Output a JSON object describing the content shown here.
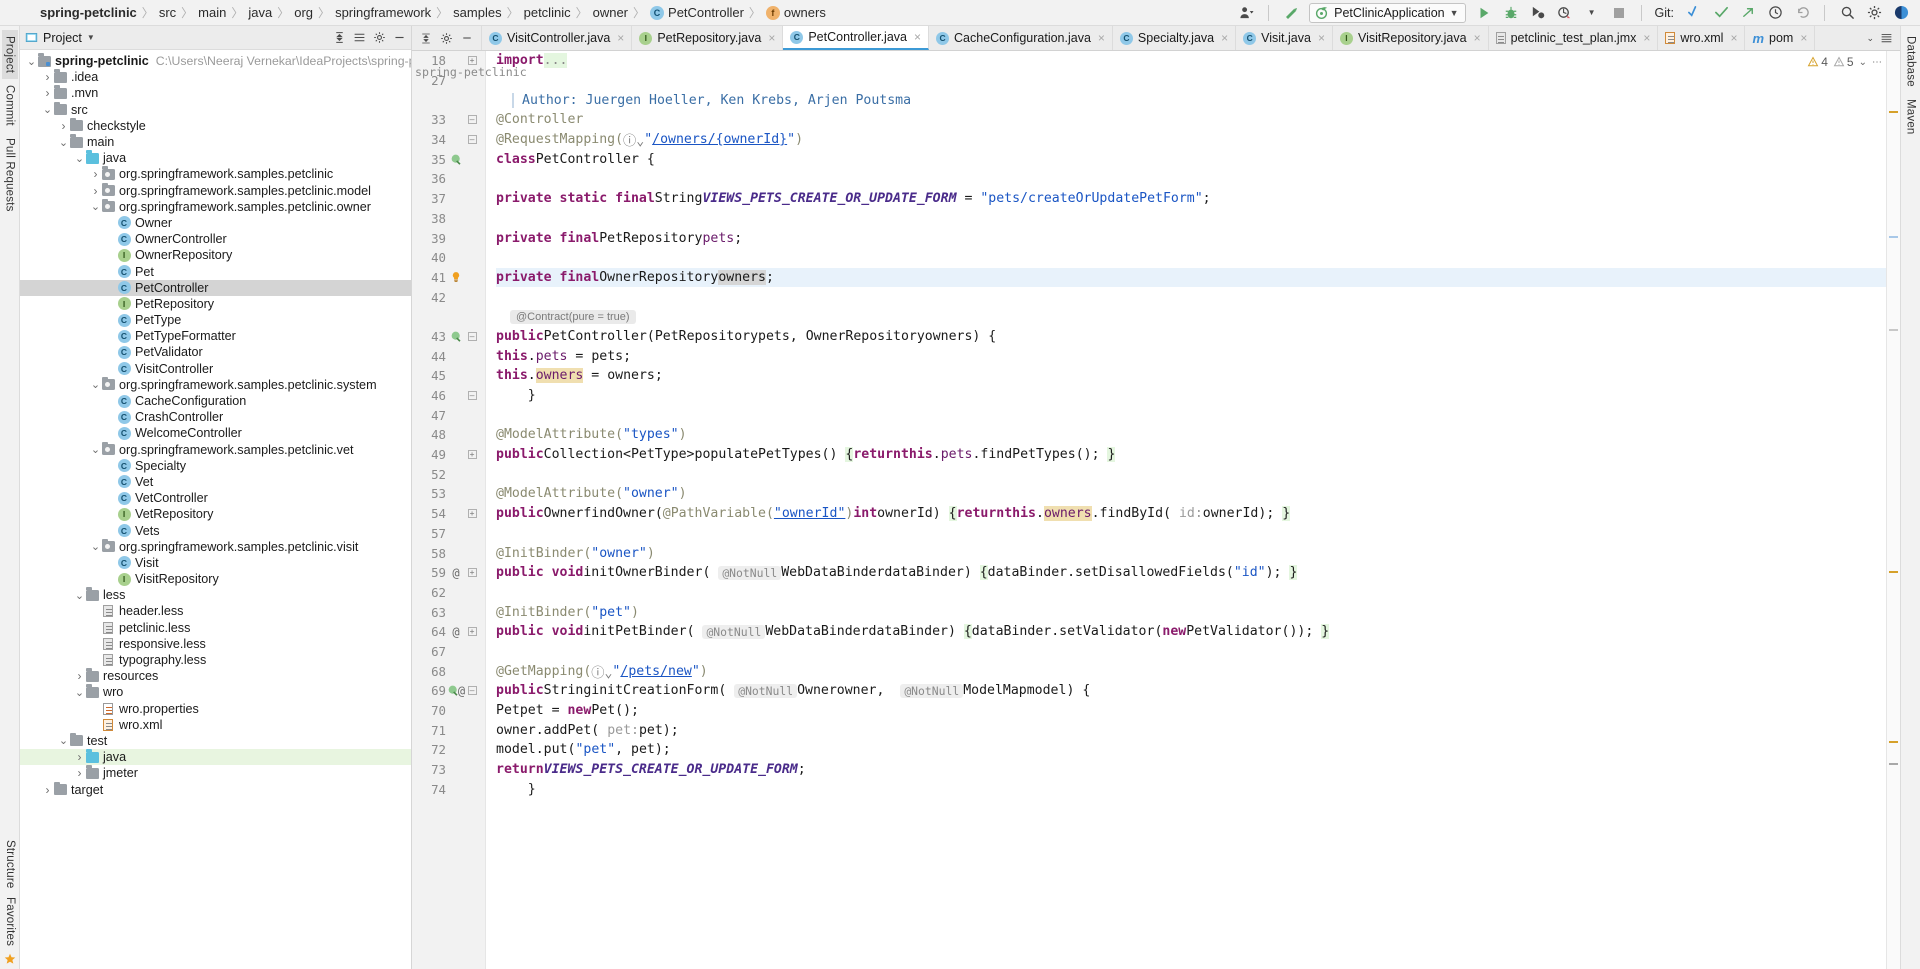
{
  "navbar": {
    "breadcrumbs": [
      {
        "label": "spring-petclinic",
        "bold": true,
        "icon": null
      },
      {
        "label": "src",
        "icon": null
      },
      {
        "label": "main",
        "icon": null
      },
      {
        "label": "java",
        "icon": null
      },
      {
        "label": "org",
        "icon": null
      },
      {
        "label": "springframework",
        "icon": null
      },
      {
        "label": "samples",
        "icon": null
      },
      {
        "label": "petclinic",
        "icon": null
      },
      {
        "label": "owner",
        "icon": null
      },
      {
        "label": "PetController",
        "icon": "class-icon"
      },
      {
        "label": "owners",
        "icon": "field-icon"
      }
    ],
    "run_config": "PetClinicApplication",
    "git_label": "Git:",
    "icons": [
      "user-avatar-icon",
      "dropdown-icon",
      "updates-icon",
      "run-icon",
      "debug-icon",
      "run-with-coverage-icon",
      "profiler-icon",
      "stop-icon",
      "update-project-icon",
      "commit-icon",
      "push-icon",
      "history-icon",
      "rollback-icon",
      "search-everywhere-icon",
      "settings-icon",
      "ide-features-icon"
    ]
  },
  "left_strip": {
    "tabs": [
      "Project",
      "Commit",
      "Pull Requests"
    ],
    "active": "Project",
    "bottom": [
      "Structure",
      "Favorites",
      "bookmark-star-icon"
    ]
  },
  "right_strip": {
    "tabs": [
      "Database",
      "Maven"
    ]
  },
  "project_panel": {
    "title": "Project",
    "header_icons": [
      "collapse-all-icon",
      "expand-icon",
      "settings-icon",
      "hide-icon"
    ],
    "tree": [
      {
        "depth": 0,
        "label": "spring-petclinic",
        "icon": "module-folder",
        "arrow": "down",
        "bold": true,
        "path": "C:\\Users\\Neeraj Vernekar\\IdeaProjects\\spring-petclinic"
      },
      {
        "depth": 1,
        "label": ".idea",
        "icon": "folder",
        "arrow": "right"
      },
      {
        "depth": 1,
        "label": ".mvn",
        "icon": "folder",
        "arrow": "right"
      },
      {
        "depth": 1,
        "label": "src",
        "icon": "folder",
        "arrow": "down"
      },
      {
        "depth": 2,
        "label": "checkstyle",
        "icon": "folder",
        "arrow": "right"
      },
      {
        "depth": 2,
        "label": "main",
        "icon": "folder",
        "arrow": "down"
      },
      {
        "depth": 3,
        "label": "java",
        "icon": "source-folder",
        "arrow": "down"
      },
      {
        "depth": 4,
        "label": "org.springframework.samples.petclinic",
        "icon": "package",
        "arrow": "right"
      },
      {
        "depth": 4,
        "label": "org.springframework.samples.petclinic.model",
        "icon": "package",
        "arrow": "right"
      },
      {
        "depth": 4,
        "label": "org.springframework.samples.petclinic.owner",
        "icon": "package",
        "arrow": "down"
      },
      {
        "depth": 5,
        "label": "Owner",
        "icon": "class"
      },
      {
        "depth": 5,
        "label": "OwnerController",
        "icon": "class"
      },
      {
        "depth": 5,
        "label": "OwnerRepository",
        "icon": "interface"
      },
      {
        "depth": 5,
        "label": "Pet",
        "icon": "class"
      },
      {
        "depth": 5,
        "label": "PetController",
        "icon": "class",
        "selected": true
      },
      {
        "depth": 5,
        "label": "PetRepository",
        "icon": "interface"
      },
      {
        "depth": 5,
        "label": "PetType",
        "icon": "class"
      },
      {
        "depth": 5,
        "label": "PetTypeFormatter",
        "icon": "class"
      },
      {
        "depth": 5,
        "label": "PetValidator",
        "icon": "class"
      },
      {
        "depth": 5,
        "label": "VisitController",
        "icon": "class"
      },
      {
        "depth": 4,
        "label": "org.springframework.samples.petclinic.system",
        "icon": "package",
        "arrow": "down"
      },
      {
        "depth": 5,
        "label": "CacheConfiguration",
        "icon": "class"
      },
      {
        "depth": 5,
        "label": "CrashController",
        "icon": "class"
      },
      {
        "depth": 5,
        "label": "WelcomeController",
        "icon": "class"
      },
      {
        "depth": 4,
        "label": "org.springframework.samples.petclinic.vet",
        "icon": "package",
        "arrow": "down"
      },
      {
        "depth": 5,
        "label": "Specialty",
        "icon": "class"
      },
      {
        "depth": 5,
        "label": "Vet",
        "icon": "class"
      },
      {
        "depth": 5,
        "label": "VetController",
        "icon": "class"
      },
      {
        "depth": 5,
        "label": "VetRepository",
        "icon": "interface"
      },
      {
        "depth": 5,
        "label": "Vets",
        "icon": "class"
      },
      {
        "depth": 4,
        "label": "org.springframework.samples.petclinic.visit",
        "icon": "package",
        "arrow": "down"
      },
      {
        "depth": 5,
        "label": "Visit",
        "icon": "class"
      },
      {
        "depth": 5,
        "label": "VisitRepository",
        "icon": "interface"
      },
      {
        "depth": 3,
        "label": "less",
        "icon": "folder",
        "arrow": "down"
      },
      {
        "depth": 4,
        "label": "header.less",
        "icon": "file"
      },
      {
        "depth": 4,
        "label": "petclinic.less",
        "icon": "file"
      },
      {
        "depth": 4,
        "label": "responsive.less",
        "icon": "file"
      },
      {
        "depth": 4,
        "label": "typography.less",
        "icon": "file"
      },
      {
        "depth": 3,
        "label": "resources",
        "icon": "folder",
        "arrow": "right"
      },
      {
        "depth": 3,
        "label": "wro",
        "icon": "folder",
        "arrow": "down"
      },
      {
        "depth": 4,
        "label": "wro.properties",
        "icon": "properties-file"
      },
      {
        "depth": 4,
        "label": "wro.xml",
        "icon": "xml-file"
      },
      {
        "depth": 2,
        "label": "test",
        "icon": "folder",
        "arrow": "down"
      },
      {
        "depth": 3,
        "label": "java",
        "icon": "source-folder",
        "arrow": "right",
        "green": true
      },
      {
        "depth": 3,
        "label": "jmeter",
        "icon": "folder",
        "arrow": "right"
      },
      {
        "depth": 1,
        "label": "target",
        "icon": "folder",
        "arrow": "right"
      }
    ]
  },
  "editor": {
    "tab_controls": [
      "collapse-icon",
      "settings-icon",
      "minimize-icon"
    ],
    "tabs": [
      {
        "label": "VisitController.java",
        "icon": "class",
        "active": false
      },
      {
        "label": "PetRepository.java",
        "icon": "interface",
        "active": false
      },
      {
        "label": "PetController.java",
        "icon": "class",
        "active": true
      },
      {
        "label": "CacheConfiguration.java",
        "icon": "class",
        "active": false
      },
      {
        "label": "Specialty.java",
        "icon": "class",
        "active": false
      },
      {
        "label": "Visit.java",
        "icon": "class",
        "active": false
      },
      {
        "label": "VisitRepository.java",
        "icon": "interface",
        "active": false
      },
      {
        "label": "petclinic_test_plan.jmx",
        "icon": "jmx-file",
        "active": false
      },
      {
        "label": "wro.xml",
        "icon": "xml-file",
        "active": false
      },
      {
        "label": "pom",
        "icon": "maven-file",
        "active": false
      }
    ],
    "tabbar_right_icons": [
      "chevron-down-icon",
      "list-icon"
    ],
    "inspection": {
      "warnings": "4",
      "weak_warnings": "5",
      "chevron": "⌄"
    },
    "side_label": "spring-petclinic",
    "lines": [
      {
        "num": "18",
        "fold": "plus",
        "type": "import"
      },
      {
        "num": "27",
        "type": "blank"
      },
      {
        "num": "",
        "type": "author",
        "text": "Author: Juergen Hoeller, Ken Krebs, Arjen Poutsma"
      },
      {
        "num": "33",
        "fold": "minus",
        "type": "anno_controller"
      },
      {
        "num": "34",
        "fold": "minus",
        "type": "request_mapping"
      },
      {
        "num": "35",
        "gmark": "recursion-icon",
        "type": "class_decl"
      },
      {
        "num": "36",
        "type": "blank"
      },
      {
        "num": "37",
        "type": "views_const"
      },
      {
        "num": "38",
        "type": "blank"
      },
      {
        "num": "39",
        "type": "pets_field"
      },
      {
        "num": "40",
        "type": "blank"
      },
      {
        "num": "41",
        "gmark": "bulb-icon",
        "type": "owners_field",
        "highlighted": true
      },
      {
        "num": "42",
        "type": "blank"
      },
      {
        "num": "",
        "type": "contract_chip",
        "text": "@Contract(pure = true)"
      },
      {
        "num": "43",
        "gmark": "recursion-icon",
        "fold": "minus",
        "type": "ctor"
      },
      {
        "num": "44",
        "type": "this_pets"
      },
      {
        "num": "45",
        "type": "this_owners"
      },
      {
        "num": "46",
        "fold": "minus",
        "type": "close_brace"
      },
      {
        "num": "47",
        "type": "blank"
      },
      {
        "num": "48",
        "type": "model_attr_types"
      },
      {
        "num": "49",
        "fold": "plus",
        "type": "populate_pet_types"
      },
      {
        "num": "52",
        "type": "blank"
      },
      {
        "num": "53",
        "type": "model_attr_owner"
      },
      {
        "num": "54",
        "fold": "plus",
        "type": "find_owner"
      },
      {
        "num": "57",
        "type": "blank"
      },
      {
        "num": "58",
        "type": "init_binder_owner"
      },
      {
        "num": "59",
        "gmark": "@",
        "fold": "plus",
        "type": "init_owner_binder"
      },
      {
        "num": "62",
        "type": "blank"
      },
      {
        "num": "63",
        "type": "init_binder_pet"
      },
      {
        "num": "64",
        "gmark": "@",
        "fold": "plus",
        "type": "init_pet_binder"
      },
      {
        "num": "67",
        "type": "blank"
      },
      {
        "num": "68",
        "type": "get_mapping_pets_new"
      },
      {
        "num": "69",
        "gmark": "recursion-at",
        "fold": "minus",
        "type": "init_creation_form"
      },
      {
        "num": "70",
        "type": "pet_new"
      },
      {
        "num": "71",
        "type": "owner_addpet"
      },
      {
        "num": "72",
        "type": "model_put"
      },
      {
        "num": "73",
        "type": "return_views"
      },
      {
        "num": "74",
        "type": "close_brace2"
      }
    ],
    "code_text": {
      "import": "import ...",
      "anno_controller": "@Controller",
      "request_mapping_head": "@RequestMapping(",
      "request_mapping_url": "\"/owners/{ownerId}\"",
      "request_mapping_tail": ")",
      "class_decl": "class PetController {",
      "views_const": "private static final String VIEWS_PETS_CREATE_OR_UPDATE_FORM = \"pets/createOrUpdatePetForm\";",
      "pets_field": "private final PetRepository pets;",
      "owners_field": "private final OwnerRepository owners;",
      "ctor": "public PetController(PetRepository pets, OwnerRepository owners) {",
      "this_pets": "this.pets = pets;",
      "this_owners": "this.owners = owners;",
      "close_brace": "}",
      "model_attr_types": "@ModelAttribute(\"types\")",
      "populate_pet_types": "public Collection<PetType> populatePetTypes() { return this.pets.findPetTypes(); }",
      "model_attr_owner": "@ModelAttribute(\"owner\")",
      "find_owner": "public Owner findOwner(@PathVariable(\"ownerId\") int ownerId) { return this.owners.findById( id: ownerId); }",
      "init_binder_owner": "@InitBinder(\"owner\")",
      "init_owner_binder": "public void initOwnerBinder( @NotNull WebDataBinder dataBinder) { dataBinder.setDisallowedFields(\"id\"); }",
      "init_binder_pet": "@InitBinder(\"pet\")",
      "init_pet_binder": "public void initPetBinder( @NotNull WebDataBinder dataBinder) { dataBinder.setValidator(new PetValidator()); }",
      "get_mapping": "@GetMapping(",
      "get_mapping_url": "\"/pets/new\"",
      "init_creation_form": "public String initCreationForm( @NotNull Owner owner,  @NotNull ModelMap model) {",
      "pet_new": "Pet pet = new Pet();",
      "owner_addpet": "owner.addPet( pet: pet);",
      "model_put": "model.put(\"pet\", pet);",
      "return_views": "return VIEWS_PETS_CREATE_OR_UPDATE_FORM;",
      "close_brace2": "}"
    }
  },
  "colors": {
    "accent": "#3c9ad6",
    "keyword": "#8a1a6b",
    "string": "#1a55c4",
    "annotation": "#8a8a70",
    "selection": "#e8f2fb",
    "occurrence": "#f0dfb0",
    "warning": "#f0a020",
    "weak_warning": "#a8a8a8",
    "git_blue": "#3c8fd6",
    "run_green": "#59a869"
  }
}
